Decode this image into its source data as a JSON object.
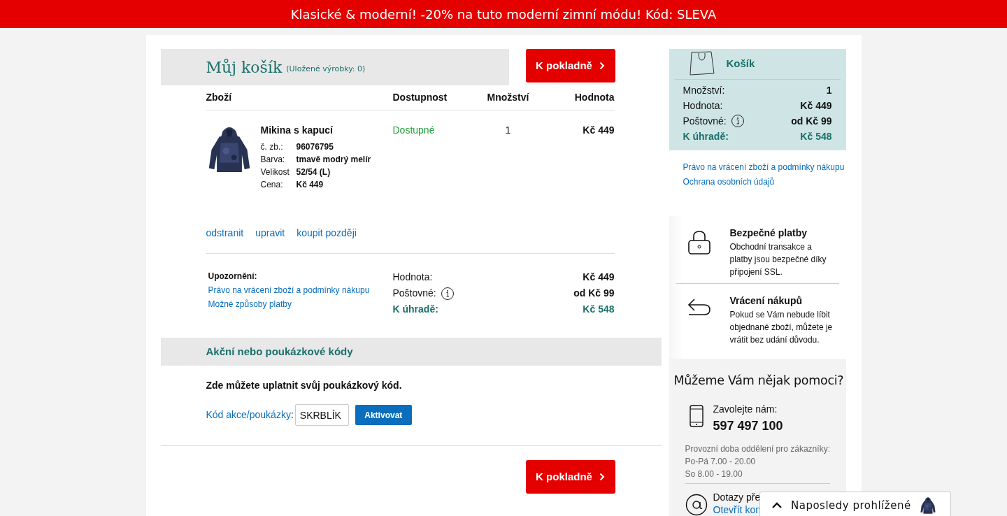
{
  "promo_banner": "Klasické & moderní! -20% na tuto moderní zimní módu! Kód: SLEVA",
  "cart": {
    "title": "Můj košík",
    "saved": "(Uložené výrobky: 0)",
    "checkout_button": "K pokladně"
  },
  "table": {
    "columns": [
      "Zboží",
      "Dostupnost",
      "Množství",
      "Hodnota"
    ],
    "rows": [
      {
        "name": "Mikina s kapucí",
        "details": [
          {
            "label": "č. zb.:",
            "value": "96076795"
          },
          {
            "label": "Barva:",
            "value": "tmavě modrý melír"
          },
          {
            "label": "Velikost",
            "value": "52/54 (L)"
          },
          {
            "label": "Cena:",
            "value": "Kč 449"
          }
        ],
        "availability": "Dostupné",
        "quantity": "1",
        "value": "Kč 449",
        "actions": [
          "odstranit",
          "upravit",
          "koupit později"
        ]
      }
    ]
  },
  "notice": {
    "title": "Upozornění:",
    "links": [
      "Právo na vrácení zboží a podmínky nákupu",
      "Možné způsoby platby"
    ]
  },
  "totals": [
    {
      "label": "Hodnota:",
      "value": "Kč 449",
      "kind": "plain"
    },
    {
      "label": "Poštovné:",
      "value": "od Kč 99",
      "kind": "info"
    },
    {
      "label": "K úhradě:",
      "value": "Kč 548",
      "kind": "total"
    }
  ],
  "voucher": {
    "heading": "Akční nebo poukázkové kódy",
    "intro": "Zde můžete uplatnit svůj poukázkový kód.",
    "label": "Kód akce/poukázky",
    "label_suffix": ":",
    "value": "SKRBLÍK",
    "button": "Aktivovat"
  },
  "bottom_checkout": "K pokladně",
  "sidebar": {
    "summary": {
      "title": "Košík",
      "rows": [
        {
          "label": "Množství:",
          "value": "1",
          "kind": "plain"
        },
        {
          "label": "Hodnota:",
          "value": "Kč 449",
          "kind": "plain"
        },
        {
          "label": "Poštovné:",
          "value": "od Kč 99",
          "kind": "info"
        },
        {
          "label": "K úhradě:",
          "value": "Kč 548",
          "kind": "total"
        }
      ]
    },
    "links": [
      "Právo na vrácení zboží a podmínky nákupu",
      "Ochrana osobních údajů"
    ],
    "trust": [
      {
        "kind": "lock",
        "title": "Bezpečné platby",
        "text": "Obchodní transakce a platby jsou bezpečné díky připojení SSL."
      },
      {
        "kind": "return",
        "title": "Vrácení nákupů",
        "text": "Pokud se Vám nebude líbit objednané zboží, můžete je vrátit bez udání důvodu."
      }
    ],
    "help": {
      "title": "Můžeme Vám nějak pomoci?",
      "phone_label": "Zavolejte nám:",
      "phone": "597 497 100",
      "hours": [
        "Provozní doba oddělení pro zákazníky:",
        "Po-Pá 7.00 - 20.00",
        "So 8.00 - 19.00"
      ],
      "email_label": "Dotazy pře",
      "email_link": "Otevřít kon"
    }
  },
  "recently_viewed": {
    "label": "Naposledy prohlížené"
  }
}
